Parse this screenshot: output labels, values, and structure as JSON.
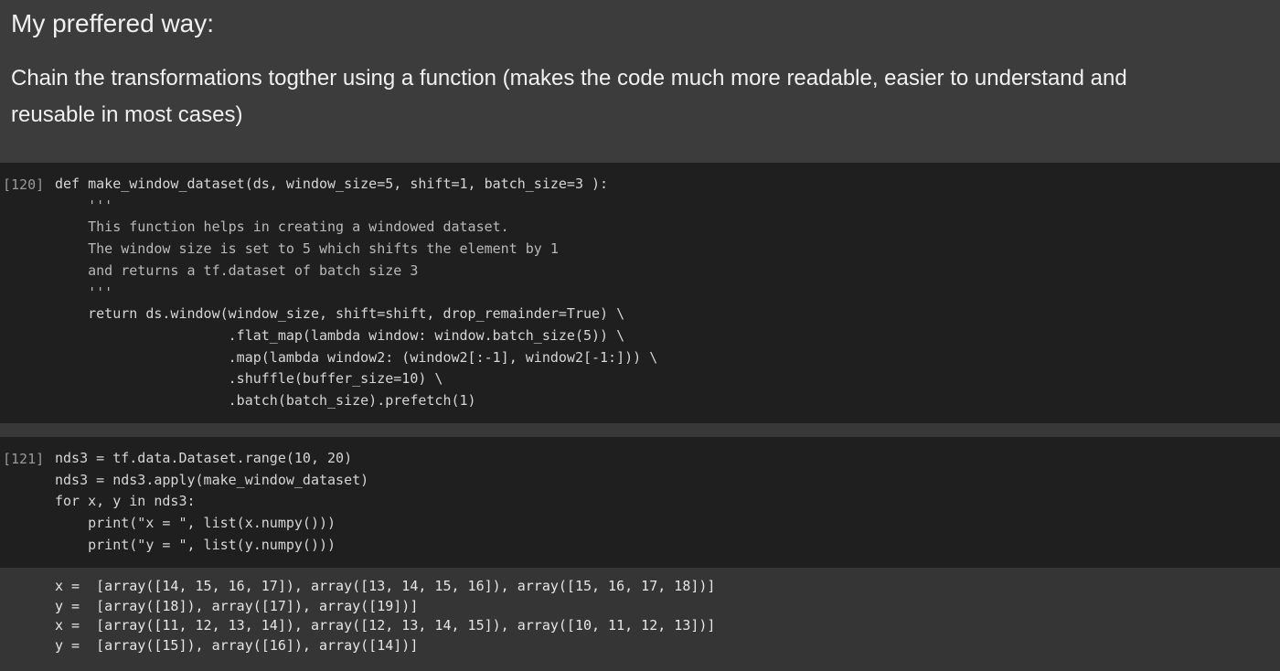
{
  "text_cell": {
    "heading": "My preffered way:",
    "paragraph": "Chain the transformations togther using a function (makes the code much more readable, easier to understand and reusable in most cases)"
  },
  "cell_1": {
    "exec_count": "[120]",
    "lines": [
      "def make_window_dataset(ds, window_size=5, shift=1, batch_size=3 ):",
      "    '''",
      "    This function helps in creating a windowed dataset.",
      "    The window size is set to 5 which shifts the element by 1",
      "    and returns a tf.dataset of batch size 3",
      "    '''",
      "    return ds.window(window_size, shift=shift, drop_remainder=True) \\",
      "                     .flat_map(lambda window: window.batch_size(5)) \\",
      "                     .map(lambda window2: (window2[:-1], window2[-1:])) \\",
      "                     .shuffle(buffer_size=10) \\",
      "                     .batch(batch_size).prefetch(1)"
    ]
  },
  "cell_2": {
    "exec_count": "[121]",
    "lines": [
      "nds3 = tf.data.Dataset.range(10, 20)",
      "nds3 = nds3.apply(make_window_dataset)",
      "for x, y in nds3:",
      "    print(\"x = \", list(x.numpy()))",
      "    print(\"y = \", list(y.numpy()))"
    ],
    "output": [
      "x =  [array([14, 15, 16, 17]), array([13, 14, 15, 16]), array([15, 16, 17, 18])]",
      "y =  [array([18]), array([17]), array([19])]",
      "x =  [array([11, 12, 13, 14]), array([12, 13, 14, 15]), array([10, 11, 12, 13])]",
      "y =  [array([15]), array([16]), array([14])]"
    ]
  }
}
